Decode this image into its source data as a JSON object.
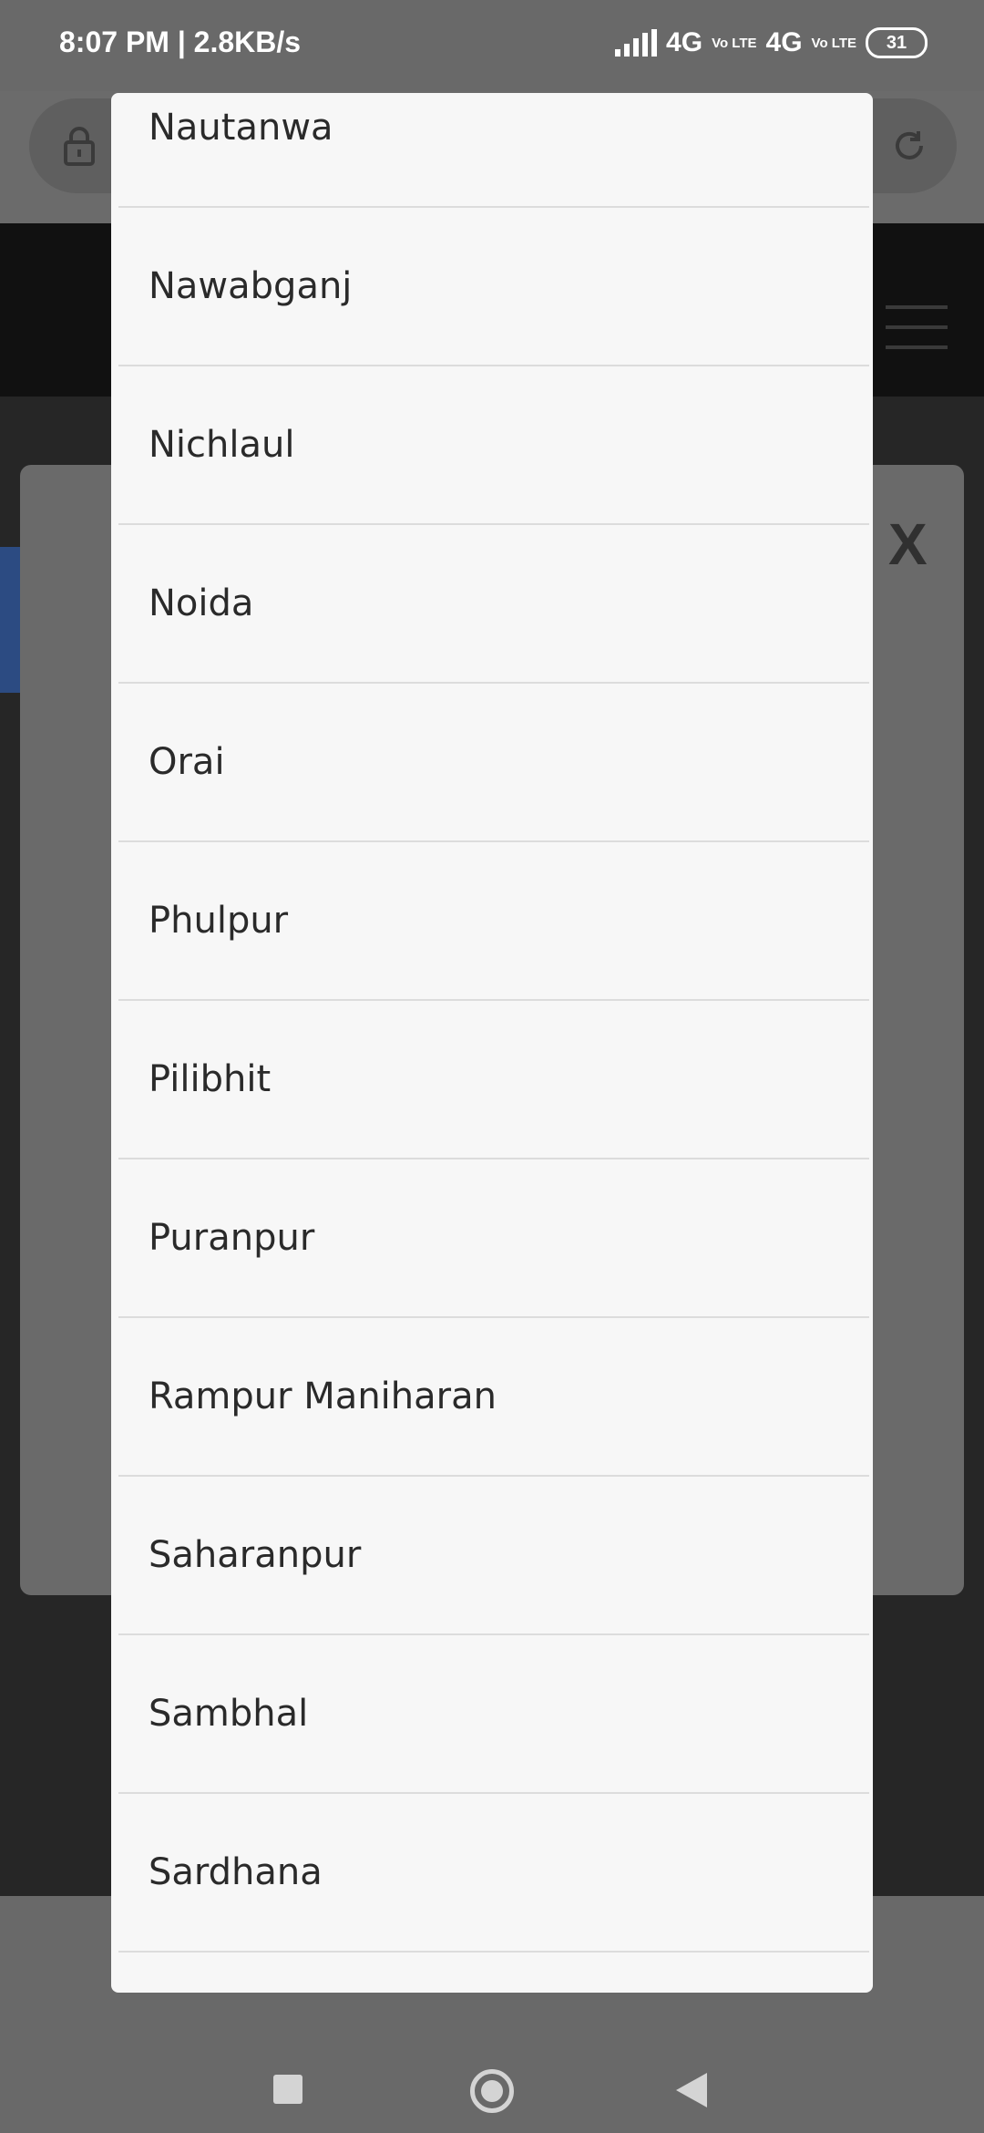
{
  "status_bar": {
    "time": "8:07 PM | 2.8KB/s",
    "network_1": "4G",
    "network_2": "4G",
    "volte_1": "Vo LTE",
    "volte_2": "Vo LTE",
    "battery": "31"
  },
  "background": {
    "close_label": "X"
  },
  "dropdown": {
    "options": [
      "Nautanwa",
      "Nawabganj",
      "Nichlaul",
      "Noida",
      "Orai",
      "Phulpur",
      "Pilibhit",
      "Puranpur",
      "Rampur Maniharan",
      "Saharanpur",
      "Sambhal",
      "Sardhana"
    ]
  },
  "colors": {
    "scrim": "#6b6b6b",
    "panel": "#f7f7f7",
    "divider": "#dcdcdc",
    "text": "#2a2a2a"
  },
  "icons": {
    "url_bar": [
      "lock-icon",
      "reload-icon"
    ],
    "header": [
      "hamburger-menu-icon"
    ],
    "nav": [
      "recents-icon",
      "home-icon",
      "back-icon"
    ]
  }
}
